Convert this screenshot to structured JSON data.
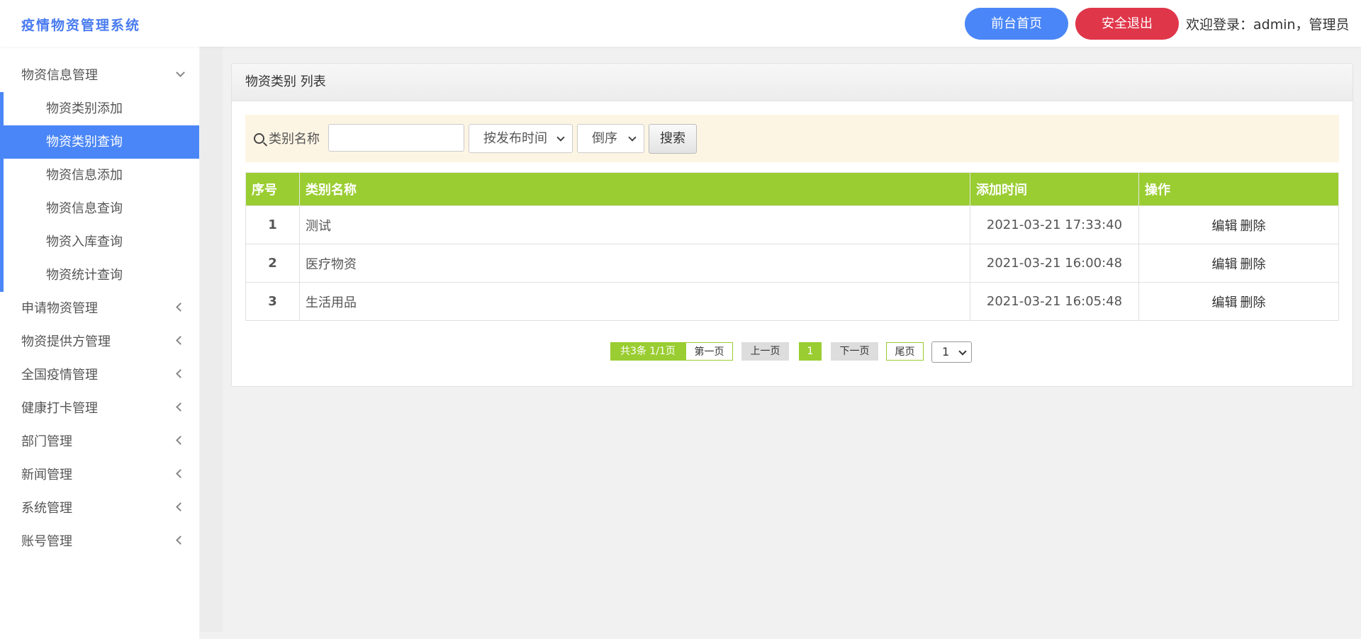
{
  "header": {
    "logo": "疫情物资管理系统",
    "home_button": "前台首页",
    "logout_button": "安全退出",
    "welcome": "欢迎登录：admin，管理员"
  },
  "sidebar": {
    "groups": [
      {
        "label": "物资信息管理",
        "expanded": true,
        "items": [
          {
            "label": "物资类别添加",
            "active": false
          },
          {
            "label": "物资类别查询",
            "active": true
          },
          {
            "label": "物资信息添加",
            "active": false
          },
          {
            "label": "物资信息查询",
            "active": false
          },
          {
            "label": "物资入库查询",
            "active": false
          },
          {
            "label": "物资统计查询",
            "active": false
          }
        ]
      },
      {
        "label": "申请物资管理",
        "expanded": false
      },
      {
        "label": "物资提供方管理",
        "expanded": false
      },
      {
        "label": "全国疫情管理",
        "expanded": false
      },
      {
        "label": "健康打卡管理",
        "expanded": false
      },
      {
        "label": "部门管理",
        "expanded": false
      },
      {
        "label": "新闻管理",
        "expanded": false
      },
      {
        "label": "系统管理",
        "expanded": false
      },
      {
        "label": "账号管理",
        "expanded": false
      }
    ]
  },
  "panel": {
    "title": "物资类别 列表"
  },
  "search": {
    "label": "类别名称",
    "input_value": "",
    "sort_select": "按发布时间",
    "order_select": "倒序",
    "button": "搜索"
  },
  "table": {
    "headers": [
      "序号",
      "类别名称",
      "添加时间",
      "操作"
    ],
    "rows": [
      {
        "idx": "1",
        "name": "测试",
        "time": "2021-03-21 17:33:40",
        "edit": "编辑",
        "delete": "删除"
      },
      {
        "idx": "2",
        "name": "医疗物资",
        "time": "2021-03-21 16:00:48",
        "edit": "编辑",
        "delete": "删除"
      },
      {
        "idx": "3",
        "name": "生活用品",
        "time": "2021-03-21 16:05:48",
        "edit": "编辑",
        "delete": "删除"
      }
    ]
  },
  "pagination": {
    "info": "共3条 1/1页",
    "first": "第一页",
    "prev": "上一页",
    "current": "1",
    "next": "下一页",
    "last": "尾页",
    "page_select": "1"
  },
  "colors": {
    "primary": "#4a86f7",
    "danger": "#e0364a",
    "table_header": "#9acd32",
    "search_bg": "#fdf5e4"
  }
}
